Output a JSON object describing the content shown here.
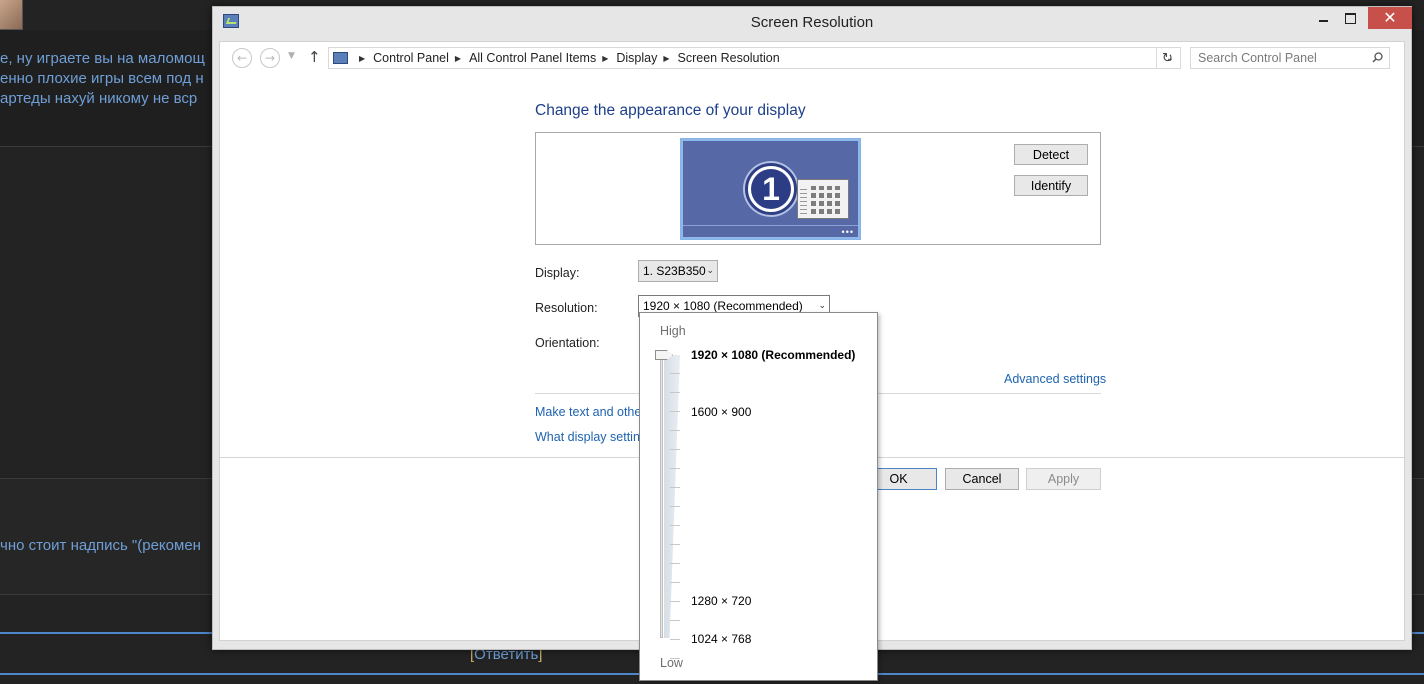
{
  "background_page": {
    "line1": "е, ну играете вы на маломощ",
    "line2": "енно плохие игры всем под н",
    "line3": "артеды нахуй никому не вср",
    "line4": "чно стоит надпись \"(рекомен",
    "reply_link": "Ответить"
  },
  "window": {
    "title": "Screen Resolution"
  },
  "address_bar": {
    "breadcrumbs": [
      "Control Panel",
      "All Control Panel Items",
      "Display",
      "Screen Resolution"
    ]
  },
  "search": {
    "placeholder": "Search Control Panel"
  },
  "main": {
    "heading": "Change the appearance of your display",
    "monitor_number": "1",
    "detect_label": "Detect",
    "identify_label": "Identify",
    "display_label": "Display:",
    "display_value": "1. S23B350",
    "resolution_label": "Resolution:",
    "resolution_value": "1920 × 1080 (Recommended)",
    "orientation_label": "Orientation:",
    "advanced_link": "Advanced settings",
    "text_size_link": "Make text and other",
    "what_display_link": "What display setting"
  },
  "footer": {
    "ok_label": "OK",
    "cancel_label": "Cancel",
    "apply_label": "Apply"
  },
  "resolution_popup": {
    "high_label": "High",
    "low_label": "Low",
    "options": [
      {
        "label": "1920 × 1080 (Recommended)",
        "selected": true
      },
      {
        "label": "1600 × 900",
        "selected": false
      },
      {
        "label": "1280 × 720",
        "selected": false
      },
      {
        "label": "1024 × 768",
        "selected": false
      }
    ]
  },
  "colors": {
    "accent_link": "#1e63b0",
    "heading": "#1e3f8b",
    "close_button": "#c7504a",
    "monitor_fill": "#5668a6"
  }
}
